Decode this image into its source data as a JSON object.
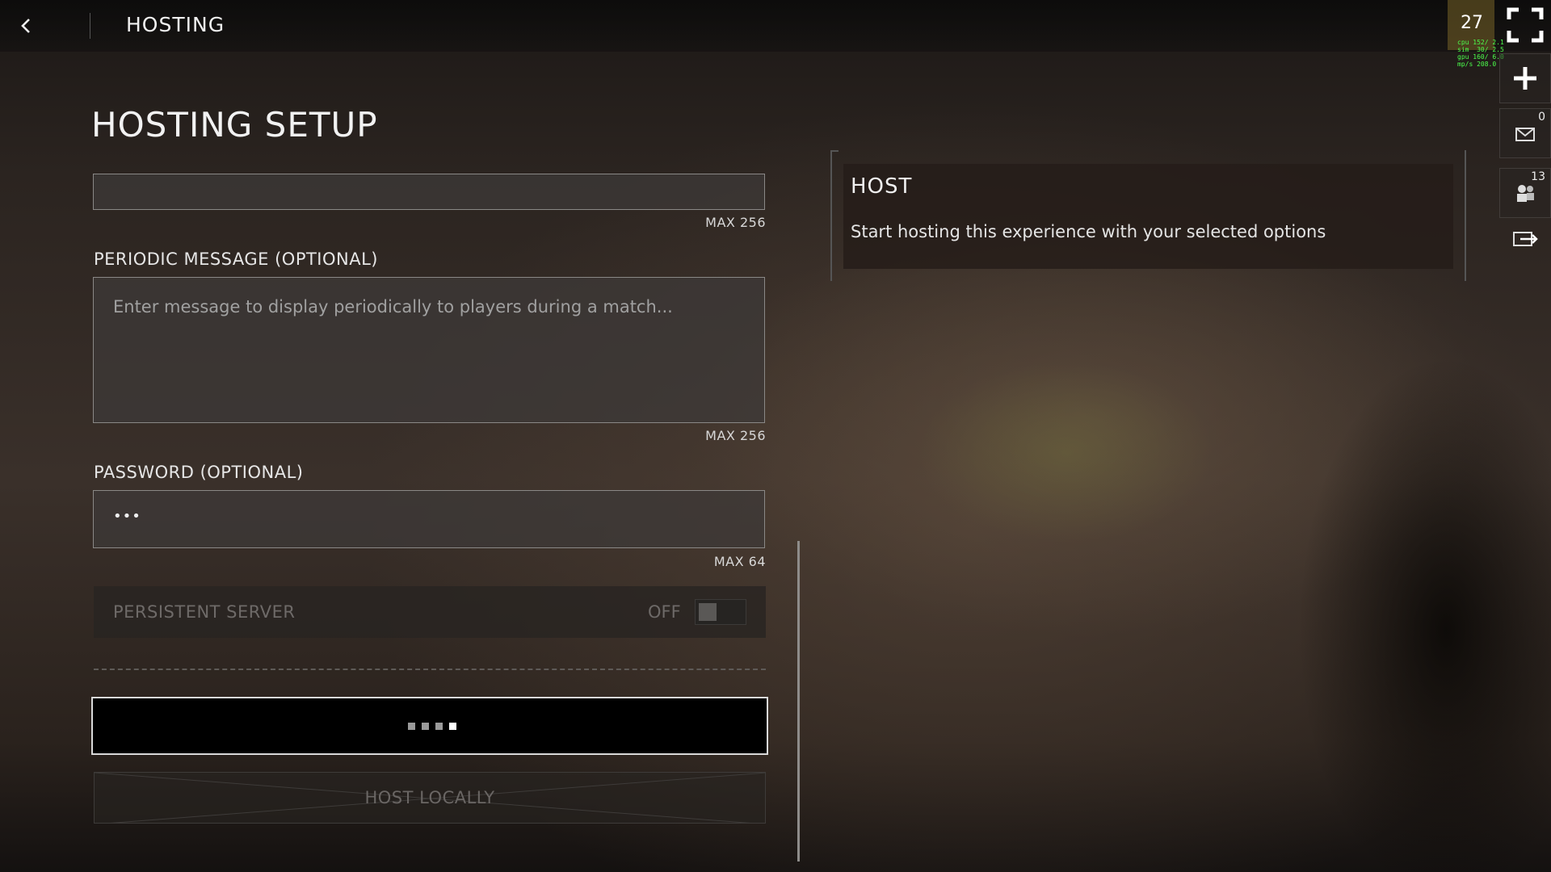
{
  "topbar": {
    "title": "HOSTING"
  },
  "page": {
    "title": "HOSTING SETUP"
  },
  "fields": {
    "top_max": "MAX 256",
    "periodic": {
      "label": "PERIODIC MESSAGE (OPTIONAL)",
      "placeholder": "Enter message to display periodically to players during a match...",
      "max": "MAX 256"
    },
    "password": {
      "label": "PASSWORD (OPTIONAL)",
      "value": "•••",
      "max": "MAX 64"
    },
    "persistent": {
      "label": "PERSISTENT SERVER",
      "state": "OFF"
    }
  },
  "buttons": {
    "host_locally": "HOST LOCALLY"
  },
  "info": {
    "title": "HOST",
    "description": "Start hosting this experience with your selected options"
  },
  "overlay": {
    "fps": "27",
    "stats": [
      "cpu 152/ 2.1",
      "sim  30/ 2.5",
      "gpu 160/ 6.0",
      "mp/s 208.0"
    ]
  },
  "side": {
    "messages_count": "0",
    "friends_count": "13"
  },
  "icons": [
    "back-arrow-icon",
    "fullscreen-icon",
    "plus-icon",
    "mail-icon",
    "friends-icon",
    "exit-icon"
  ]
}
